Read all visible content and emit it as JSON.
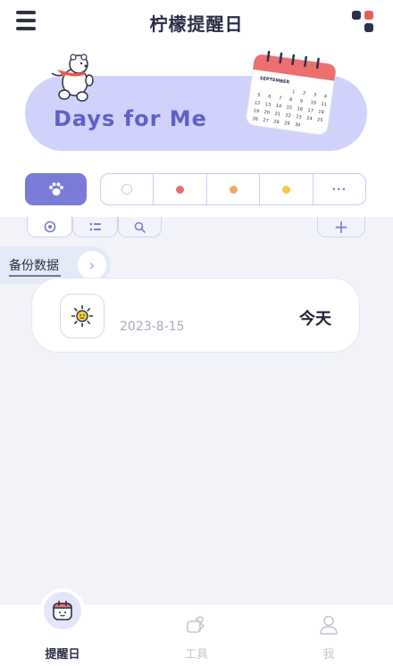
{
  "app": {
    "title": "柠檬提醒日",
    "menu_icon": "hamburger-menu-icon",
    "apps_icon": "four-dots-icon"
  },
  "banner": {
    "text": "Days for Me",
    "calendar_month": "SEPTEMBER",
    "background": "#d1d2fb",
    "text_color": "#5f60c7"
  },
  "filters": {
    "primary_icon": "paw-icon",
    "primary_color": "#7a7bd6",
    "colors": [
      "hollow",
      "#ec6a6a",
      "#f6a865",
      "#f4c943"
    ],
    "more_label": "···"
  },
  "tabs": [
    {
      "icon": "target-icon",
      "active": true
    },
    {
      "icon": "list-icon",
      "active": false
    },
    {
      "icon": "search-icon",
      "active": false
    }
  ],
  "add_label": "+",
  "backup": {
    "label": "备份数据",
    "arrow": "›"
  },
  "events": [
    {
      "icon": "sun-icon",
      "date": "2023-8-15",
      "status": "今天"
    }
  ],
  "bottom_nav": [
    {
      "label": "提醒日",
      "icon": "calendar-face-icon",
      "active": true
    },
    {
      "label": "工具",
      "icon": "tools-icon",
      "active": false
    },
    {
      "label": "我",
      "icon": "user-icon",
      "active": false
    }
  ]
}
